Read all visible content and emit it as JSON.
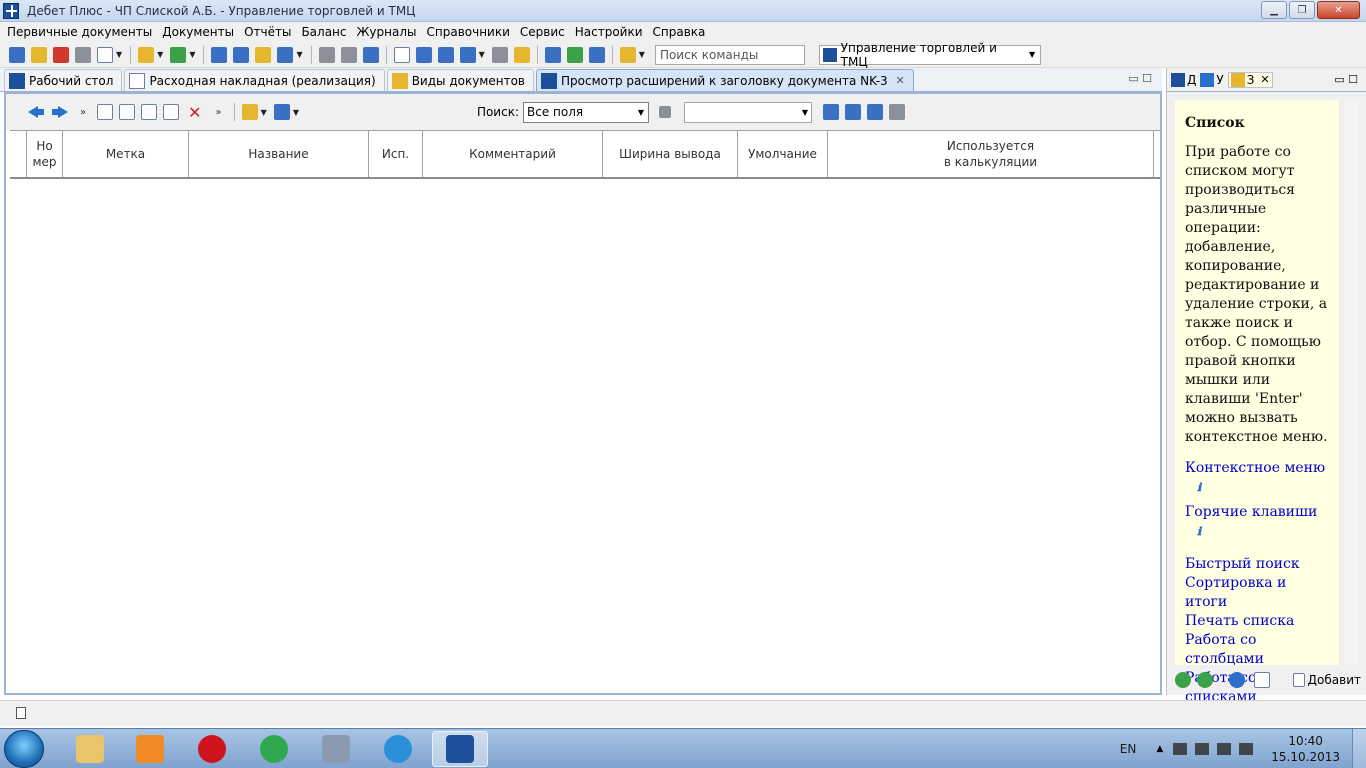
{
  "window": {
    "title": "Дебет Плюс - ЧП Слиской А.Б. - Управление торговлей и ТМЦ"
  },
  "menu": [
    "Первичные документы",
    "Документы",
    "Отчёты",
    "Баланс",
    "Журналы",
    "Справочники",
    "Сервис",
    "Настройки",
    "Справка"
  ],
  "toolbar": {
    "command_search_placeholder": "Поиск команды",
    "configuration": "Управление торговлей и ТМЦ"
  },
  "tabs": [
    {
      "label": "Рабочий стол",
      "active": false
    },
    {
      "label": "Расходная накладная (реализация)",
      "active": false
    },
    {
      "label": "Виды документов",
      "active": false
    },
    {
      "label": "Просмотр расширений к заголовку документа NK-3",
      "active": true
    }
  ],
  "list_toolbar": {
    "search_label": "Поиск:",
    "search_scope": "Все поля",
    "search_value": ""
  },
  "grid": {
    "columns": [
      [
        "Но",
        "мер"
      ],
      [
        "Метка"
      ],
      [
        "Название"
      ],
      [
        "Исп."
      ],
      [
        "Комментарий"
      ],
      [
        "Ширина вывода"
      ],
      [
        "Умолчание"
      ],
      [
        "Используется",
        "в калькуляции"
      ]
    ],
    "rows": []
  },
  "side_panel": {
    "tabs": [
      "Д",
      "У",
      "З"
    ],
    "help": {
      "heading": "Список",
      "body": "При работе со списком могут производиться различные операции: добавление, копирование, редактирование и удаление строки, а также поиск и отбор. С помощью правой кнопки мышки или клавиши 'Enter' можно вызвать контекстное меню.",
      "info_links": [
        "Контекстное меню",
        "Горячие клавиши"
      ],
      "links": [
        "Быстрый поиск",
        "Сортировка и итоги",
        "Печать списка",
        "Работа со столбцами",
        "Работа со списками"
      ]
    },
    "add_button": "Добавит"
  },
  "taskbar": {
    "lang": "EN",
    "time": "10:40",
    "date": "15.10.2013"
  },
  "colors": {
    "tab_active_bg": "#d6e4f7",
    "help_bg": "#ffffe1",
    "link": "#0000cc"
  }
}
